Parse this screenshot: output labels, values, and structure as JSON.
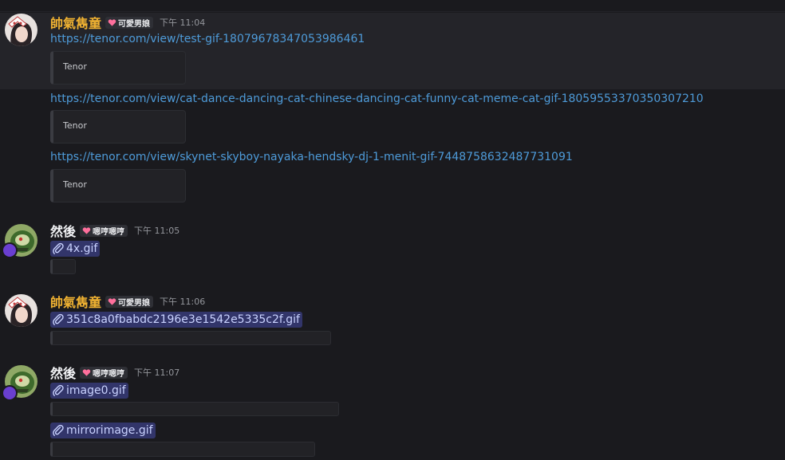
{
  "colors": {
    "username_gold": "#f0b232",
    "username_white": "#f2f3f5",
    "link": "#4e9bd9",
    "attachment_bg": "#32356a"
  },
  "messages": [
    {
      "username": "帥氣雋童",
      "badge": "可愛男娘",
      "timestamp": "下午 11:04",
      "links": [
        {
          "url": "https://tenor.com/view/test-gif-18079678347053986461",
          "embed_label": "Tenor"
        },
        {
          "url": "https://tenor.com/view/cat-dance-dancing-cat-chinese-dancing-cat-funny-cat-meme-cat-gif-18059553370350307210",
          "embed_label": "Tenor"
        },
        {
          "url": "https://tenor.com/view/skynet-skyboy-nayaka-hendsky-dj-1-menit-gif-7448758632487731091",
          "embed_label": "Tenor"
        }
      ]
    },
    {
      "username": "然後",
      "badge": "嗯哼嗯哼",
      "timestamp": "下午 11:05",
      "attachments": [
        {
          "filename": "4x.gif"
        }
      ]
    },
    {
      "username": "帥氣雋童",
      "badge": "可愛男娘",
      "timestamp": "下午 11:06",
      "attachments": [
        {
          "filename": "351c8a0fbabdc2196e3e1542e5335c2f.gif"
        }
      ]
    },
    {
      "username": "然後",
      "badge": "嗯哼嗯哼",
      "timestamp": "下午 11:07",
      "attachments": [
        {
          "filename": "image0.gif"
        },
        {
          "filename": "mirrorimage.gif"
        }
      ]
    }
  ]
}
